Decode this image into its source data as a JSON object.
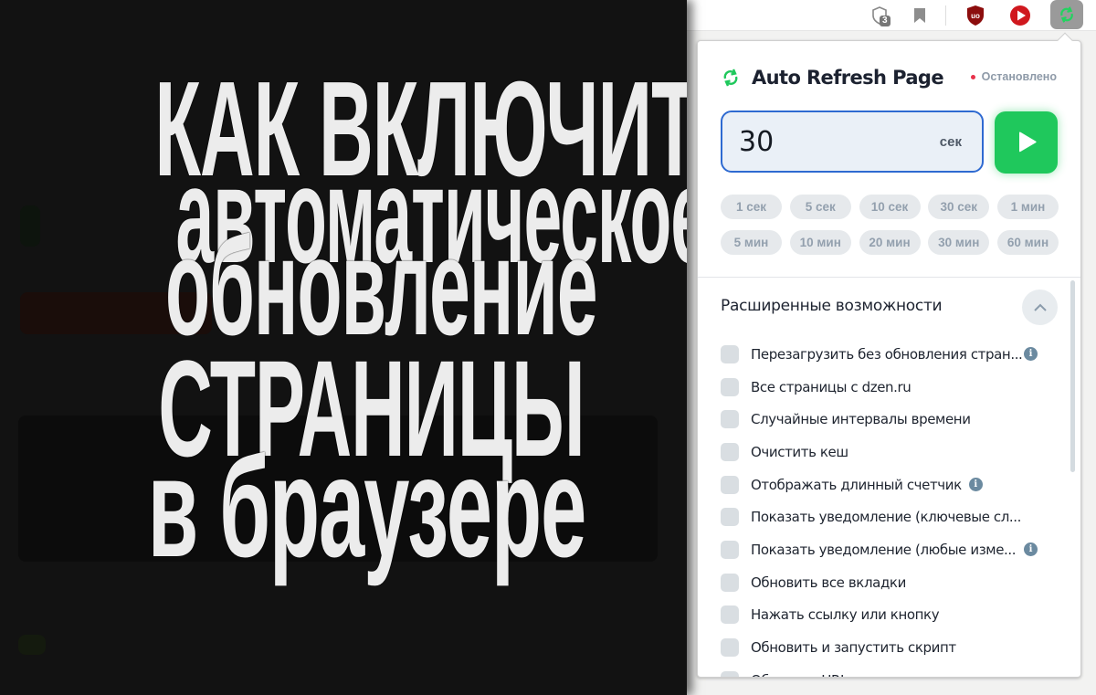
{
  "headline": {
    "lines": [
      "КАК ВКЛЮЧИТЬ",
      "автоматическое",
      "обновление",
      "СТРАНИЦЫ",
      "в браузере"
    ]
  },
  "toolbar": {
    "icons": [
      "shield-icon",
      "bookmark-icon",
      "ublock-icon",
      "video-player-icon",
      "auto-refresh-extension-icon"
    ],
    "shield_badge": "3"
  },
  "popup": {
    "title": "Auto Refresh Page",
    "status": "Остановлено",
    "colors": {
      "accent": "#1fc85c",
      "input_border": "#2e6ad1",
      "status_dot": "#e8324a"
    },
    "interval": {
      "value": "30",
      "unit": "сек"
    },
    "start_button": "play-icon",
    "presets": [
      [
        "1 сек",
        "5 сек",
        "10 сек",
        "30 сек",
        "1 мин"
      ],
      [
        "5 мин",
        "10 мин",
        "20 мин",
        "30 мин",
        "60 мин"
      ]
    ],
    "advanced": {
      "title": "Расширенные возможности",
      "options": [
        {
          "label": "Перезагрузить без обновления стран...",
          "checked": false,
          "info": true
        },
        {
          "label": "Все страницы с dzen.ru",
          "checked": false,
          "info": false
        },
        {
          "label": "Случайные интервалы времени",
          "checked": false,
          "info": false
        },
        {
          "label": "Очистить кеш",
          "checked": false,
          "info": false
        },
        {
          "label": "Отображать длинный счетчик",
          "checked": false,
          "info": true
        },
        {
          "label": "Показать уведомление (ключевые сл...",
          "checked": false,
          "info": false
        },
        {
          "label": "Показать уведомление (любые изме...",
          "checked": false,
          "info": true
        },
        {
          "label": "Обновить все вкладки",
          "checked": false,
          "info": false
        },
        {
          "label": "Нажать ссылку или кнопку",
          "checked": false,
          "info": false
        },
        {
          "label": "Обновить и запустить скрипт",
          "checked": false,
          "info": false
        },
        {
          "label": "Обновить URL",
          "checked": false,
          "info": false
        }
      ]
    }
  }
}
